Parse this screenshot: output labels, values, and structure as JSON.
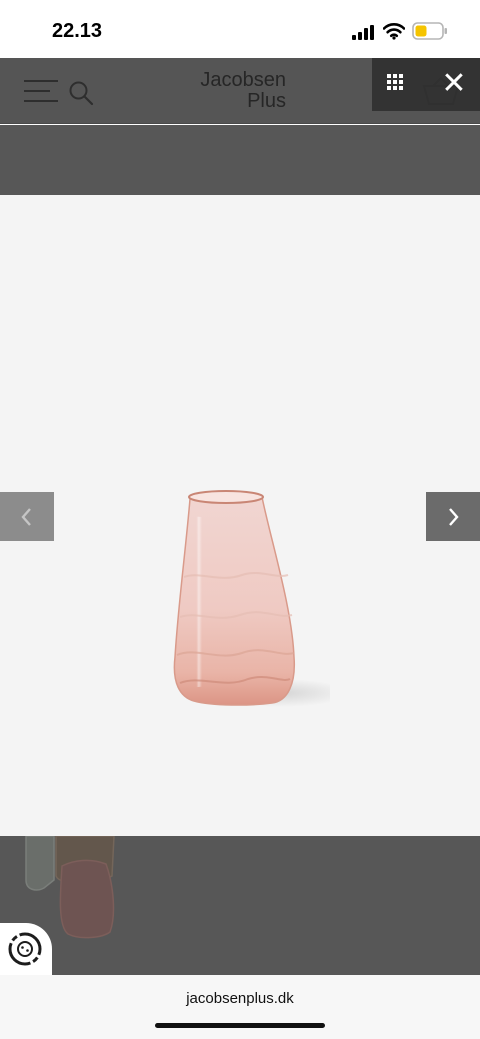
{
  "status_bar": {
    "time": "22.13",
    "battery_color": "#f5c400"
  },
  "header": {
    "brand_line1": "Jacobsen",
    "brand_line2": "Plus",
    "overlay_color": "#555555"
  },
  "lightbox": {
    "toolbar_color": "#303030",
    "prev_icon": "chevron-left-icon",
    "next_icon": "chevron-right-icon",
    "grid_icon": "grid-icon",
    "close_glyph": "✕"
  },
  "product_image": {
    "subject": "rose-tinted textured glass vase",
    "background": "#f4f4f4"
  },
  "browser": {
    "url": "jacobsenplus.dk"
  }
}
